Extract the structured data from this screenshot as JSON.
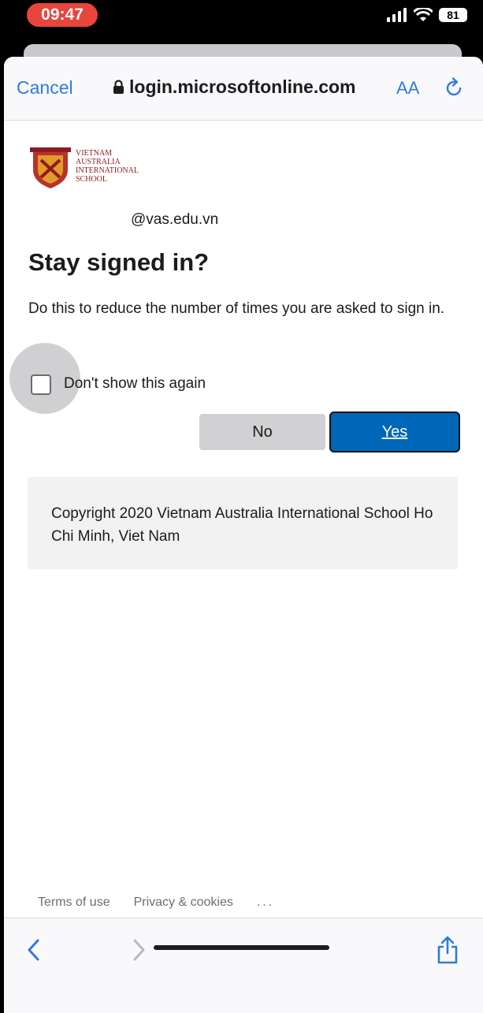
{
  "status_bar": {
    "time": "09:47",
    "battery": "81"
  },
  "browser": {
    "cancel_label": "Cancel",
    "url": "login.microsoftonline.com",
    "text_size_label": "AA"
  },
  "page": {
    "logo_lines": [
      "VIETNAM",
      "AUSTRALIA",
      "INTERNATIONAL",
      "SCHOOL"
    ],
    "email": "@vas.edu.vn",
    "title": "Stay signed in?",
    "description": "Do this to reduce the number of times you are asked to sign in.",
    "checkbox_label": "Don't show this again",
    "checkbox_checked": false,
    "no_button": "No",
    "yes_button": "Yes",
    "copyright": "Copyright 2020 Vietnam Australia International School Ho Chi Minh, Viet Nam",
    "terms_link": "Terms of use",
    "privacy_link": "Privacy & cookies",
    "more_link": "...",
    "colors": {
      "accent": "#0067b8",
      "link": "#2f7bdb",
      "brand": "#8e1b1f"
    }
  }
}
